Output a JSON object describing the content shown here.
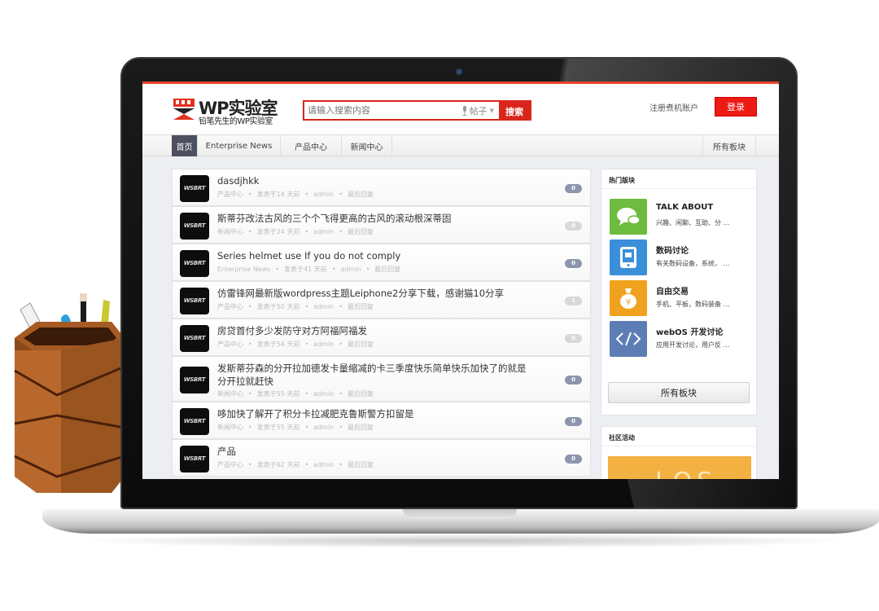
{
  "site": {
    "logo_title": "WP实验室",
    "logo_subtitle": "铅笔先生的WP实验室",
    "accent_color": "#d9261c"
  },
  "search": {
    "placeholder": "请输入搜索内容",
    "scope": "帖子",
    "button_label": "搜索"
  },
  "account": {
    "register_label": "注册煮机账户",
    "login_label": "登录"
  },
  "nav": {
    "items": [
      {
        "label": "首页",
        "active": true
      },
      {
        "label": "Enterprise News"
      },
      {
        "label": "产品中心"
      },
      {
        "label": "新闻中心"
      }
    ],
    "all_boards_label": "所有板块"
  },
  "posts": [
    {
      "title": "dasdjhkk",
      "category": "产品中心",
      "time": "发表于14 天前",
      "author": "admin",
      "reply": "最后回复",
      "count": "0",
      "badge": "dark"
    },
    {
      "title": "斯蒂芬改法古风的三个个飞得更高的古风的滚动根深蒂固",
      "category": "新闻中心",
      "time": "发表于24 天前",
      "author": "admin",
      "reply": "最后回复",
      "count": "0",
      "badge": "light"
    },
    {
      "title": "Series helmet use If you do not comply",
      "category": "Enterprise News",
      "time": "发表于41 天前",
      "author": "admin",
      "reply": "最后回复",
      "count": "0",
      "badge": "dark"
    },
    {
      "title": "仿雷锋网最新版wordpress主题Leiphone2分享下载，感谢猫10分享",
      "category": "产品中心",
      "time": "发表于50 天前",
      "author": "admin",
      "reply": "最后回复",
      "count": "1",
      "badge": "light"
    },
    {
      "title": "房贷首付多少发防守对方阿福阿福发",
      "category": "产品中心",
      "time": "发表于54 天前",
      "author": "admin",
      "reply": "最后回复",
      "count": "0",
      "badge": "light"
    },
    {
      "title": "发斯蒂芬森的分开拉加德发卡量缩减的卡三季度快乐简单快乐加快了的就是",
      "title_line2": "分开拉就赶快",
      "category": "新闻中心",
      "time": "发表于55 天前",
      "author": "admin",
      "reply": "最后回复",
      "count": "0",
      "badge": "dark"
    },
    {
      "title": "哆加快了解开了积分卡拉减肥克鲁斯警方扣留是",
      "category": "新闻中心",
      "time": "发表于55 天前",
      "author": "admin",
      "reply": "最后回复",
      "count": "0",
      "badge": "dark"
    },
    {
      "title": "产品",
      "category": "产品中心",
      "time": "发表于62 天前",
      "author": "admin",
      "reply": "最后回复",
      "count": "0",
      "badge": "dark"
    }
  ],
  "avatar_text": "WSBRT",
  "sidebar": {
    "hot_title": "热门版块",
    "boards": [
      {
        "name": "TALK ABOUT",
        "desc": "兴趣、闲聊、互助、分 …",
        "icon": "chat-bubbles-icon",
        "color": "#6dbb3f"
      },
      {
        "name": "数码讨论",
        "desc": "有关数码设备，系统， …",
        "icon": "tablet-icon",
        "color": "#3b8fd9"
      },
      {
        "name": "自由交易",
        "desc": "手机、平板，数码装备 …",
        "icon": "money-bag-icon",
        "color": "#f0a21e"
      },
      {
        "name": "webOS 开发讨论",
        "desc": "应用开发讨论，用户反 …",
        "icon": "code-icon",
        "color": "#5d7db5"
      }
    ],
    "all_boards_button": "所有板块",
    "community_title": "社区活动",
    "promo_text": "LOS"
  }
}
